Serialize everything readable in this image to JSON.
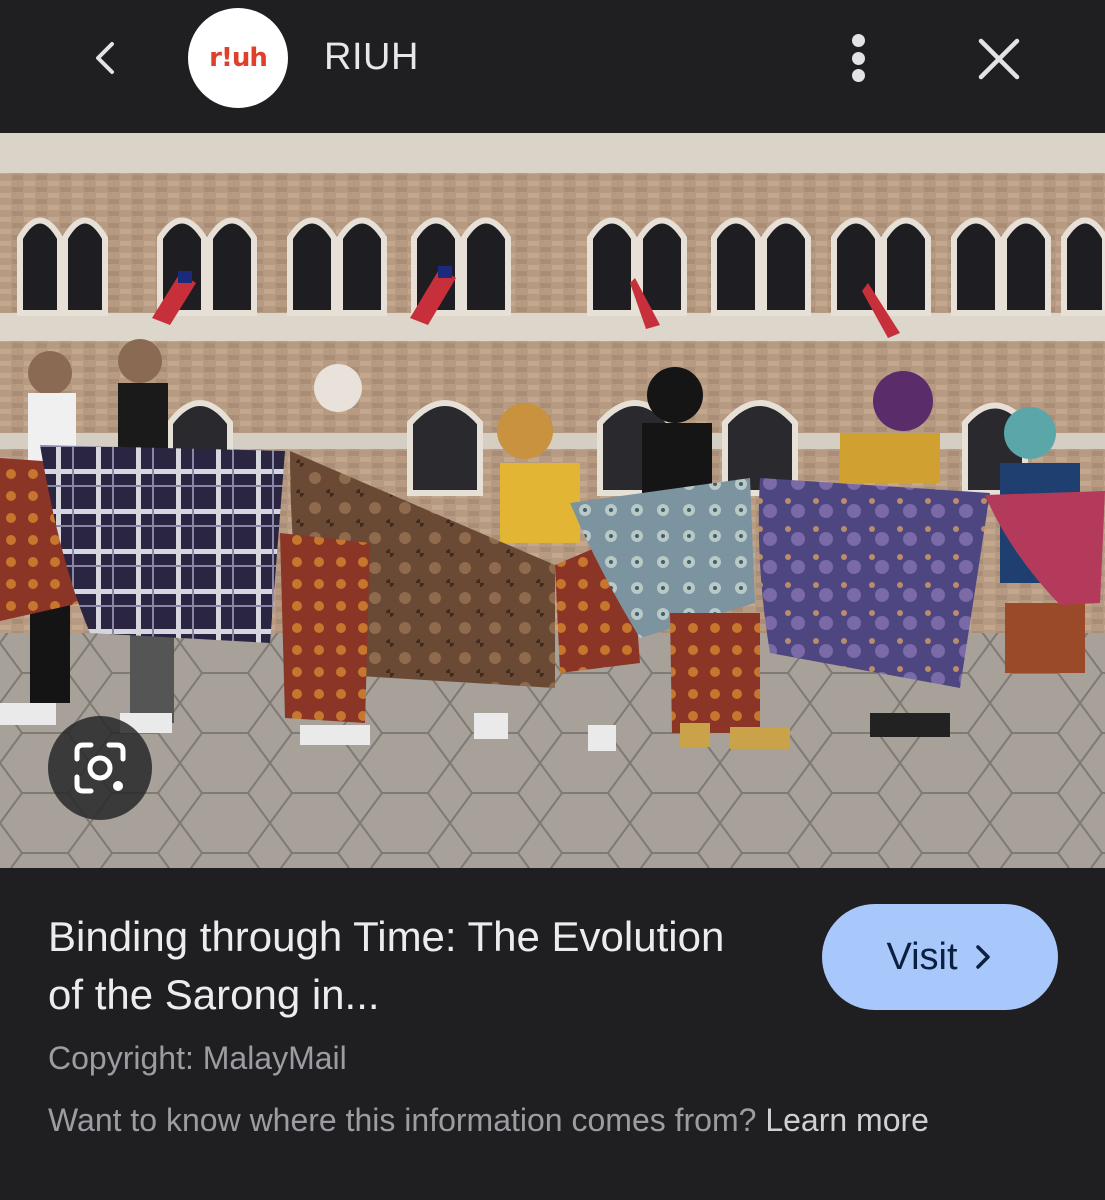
{
  "header": {
    "back_icon": "chevron-left-icon",
    "logo_text": "r!uh",
    "site_name": "RIUH",
    "more_icon": "more-vert-icon",
    "close_icon": "close-icon"
  },
  "image": {
    "lens_icon": "google-lens-icon"
  },
  "result": {
    "title": "Binding through Time: The Evolution of the Sarong in...",
    "visit_label": "Visit",
    "visit_icon": "chevron-right-icon",
    "copyright": "Copyright: MalayMail",
    "source_prompt": "Want to know where this information comes from?",
    "learn_more": "Learn more"
  },
  "colors": {
    "background": "#1f1f22",
    "visit_button": "#a8c7fa",
    "logo_red": "#e0402a"
  }
}
